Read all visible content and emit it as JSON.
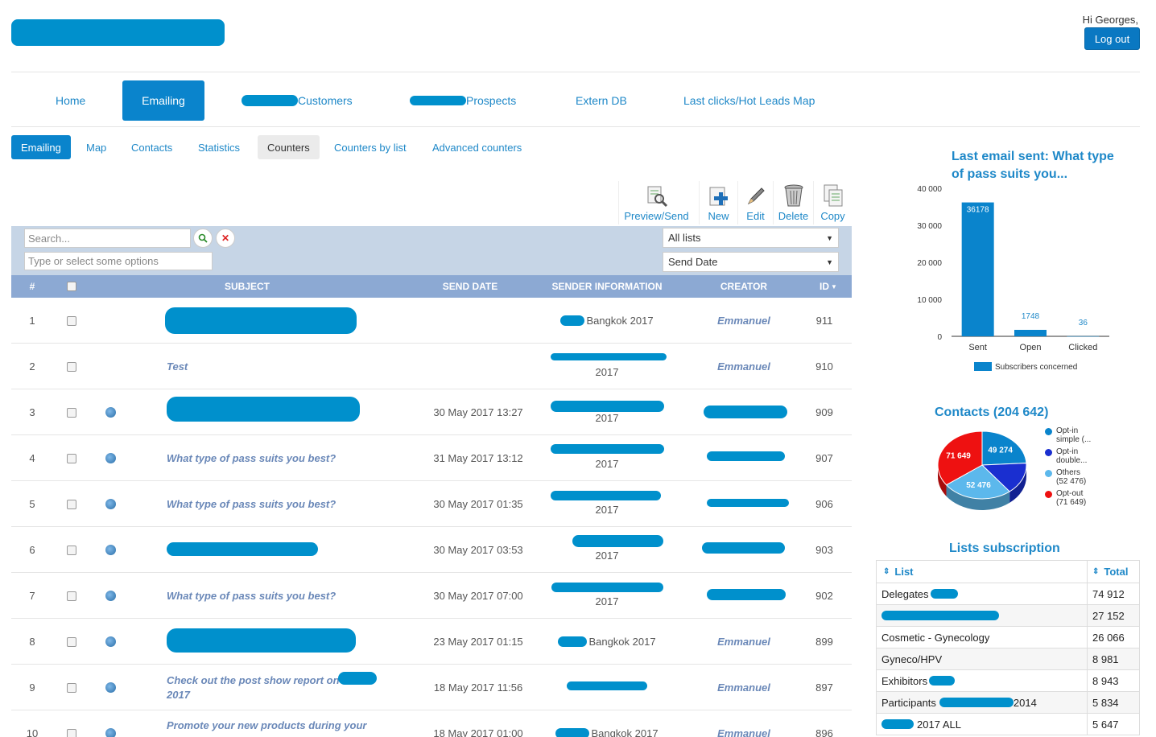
{
  "header": {
    "greeting": "Hi Georges,",
    "logout_label": "Log out"
  },
  "main_nav": {
    "home": "Home",
    "emailing": "Emailing",
    "customers": "Customers",
    "prospects": "Prospects",
    "extern_db": "Extern DB",
    "last_clicks": "Last clicks/Hot Leads Map"
  },
  "sub_nav": {
    "emailing": "Emailing",
    "map": "Map",
    "contacts": "Contacts",
    "statistics": "Statistics",
    "counters": "Counters",
    "counters_by_list": "Counters by list",
    "advanced_counters": "Advanced counters"
  },
  "toolbar": {
    "preview_send": "Preview/Send",
    "new": "New",
    "edit": "Edit",
    "delete": "Delete",
    "copy": "Copy"
  },
  "filters": {
    "search_placeholder": "Search...",
    "options_placeholder": "Type or select some options",
    "lists_value": "All lists",
    "sort_value": "Send Date"
  },
  "table": {
    "headers": {
      "num": "#",
      "subject": "SUBJECT",
      "send_date": "SEND DATE",
      "sender": "SENDER INFORMATION",
      "creator": "CREATOR",
      "id": "ID"
    },
    "rows": [
      {
        "num": "1",
        "subject": "",
        "date": "",
        "sender": "Bangkok 2017",
        "creator": "Emmanuel",
        "id": "911"
      },
      {
        "num": "2",
        "subject": "Test",
        "date": "",
        "sender": "2017",
        "creator": "Emmanuel",
        "id": "910"
      },
      {
        "num": "3",
        "subject": "",
        "date": "30 May 2017 13:27",
        "sender": "2017",
        "creator": "",
        "id": "909"
      },
      {
        "num": "4",
        "subject": "What type of pass suits you best?",
        "date": "31 May 2017 13:12",
        "sender": "2017",
        "creator": "",
        "id": "907"
      },
      {
        "num": "5",
        "subject": "What type of pass suits you best?",
        "date": "30 May 2017 01:35",
        "sender": "2017",
        "creator": "",
        "id": "906"
      },
      {
        "num": "6",
        "subject": "",
        "date": "30 May 2017 03:53",
        "sender": "2017",
        "creator": "",
        "id": "903"
      },
      {
        "num": "7",
        "subject": "What type of pass suits you best?",
        "date": "30 May 2017 07:00",
        "sender": "2017",
        "creator": "",
        "id": "902"
      },
      {
        "num": "8",
        "subject": "",
        "date": "23 May 2017 01:15",
        "sender": "Bangkok 2017",
        "creator": "Emmanuel",
        "id": "899"
      },
      {
        "num": "9",
        "subject": "Check out the post show report on 2017",
        "date": "18 May 2017 11:56",
        "sender": "",
        "creator": "Emmanuel",
        "id": "897"
      },
      {
        "num": "10",
        "subject": "Promote your new products during your",
        "date": "18 May 2017 01:00",
        "sender": "Bangkok 2017",
        "creator": "Emmanuel",
        "id": "896"
      }
    ]
  },
  "last_email": {
    "title": "Last email sent: What type of pass suits you..."
  },
  "chart_data": [
    {
      "type": "bar",
      "title": "Last email sent: What type of pass suits you...",
      "categories": [
        "Sent",
        "Open",
        "Clicked"
      ],
      "values": [
        36178,
        1748,
        36
      ],
      "value_labels": [
        "36178",
        "1748",
        "36"
      ],
      "ylim": [
        0,
        40000
      ],
      "yticks": [
        "0",
        "10 000",
        "20 000",
        "30 000",
        "40 000"
      ],
      "legend": "Subscribers concerned",
      "color": "#0a84cc"
    },
    {
      "type": "pie",
      "title": "Contacts (204 642)",
      "slices": [
        {
          "name": "Opt-in simple (...",
          "value": 49274,
          "label": "49 274",
          "color": "#0a84cc"
        },
        {
          "name": "Opt-in double...",
          "value": 31243,
          "label": "",
          "color": "#1a2fd0"
        },
        {
          "name": "Others (52 476)",
          "value": 52476,
          "label": "52 476",
          "color": "#5cb8ec"
        },
        {
          "name": "Opt-out (71 649)",
          "value": 71649,
          "label": "71 649",
          "color": "#ee1111"
        }
      ]
    }
  ],
  "contacts": {
    "title": "Contacts (204 642)",
    "legend": [
      {
        "line1": "Opt-in",
        "line2": "simple (...",
        "color": "#0a84cc"
      },
      {
        "line1": "Opt-in",
        "line2": "double...",
        "color": "#1a2fd0"
      },
      {
        "line1": "Others",
        "line2": "(52 476)",
        "color": "#5cb8ec"
      },
      {
        "line1": "Opt-out",
        "line2": "(71 649)",
        "color": "#ee1111"
      }
    ]
  },
  "lists": {
    "title": "Lists subscription",
    "col_list": "List",
    "col_total": "Total",
    "rows": [
      {
        "name": "Delegates",
        "total": "74 912"
      },
      {
        "name": "",
        "total": "27 152"
      },
      {
        "name": "Cosmetic - Gynecology",
        "total": "26 066"
      },
      {
        "name": "Gyneco/HPV",
        "total": "8 981"
      },
      {
        "name": "Exhibitors",
        "total": "8 943"
      },
      {
        "name": "Participants",
        "suffix": "2014",
        "total": "5 834"
      },
      {
        "name": "",
        "suffix": "2017 ALL",
        "total": "5 647"
      }
    ]
  }
}
